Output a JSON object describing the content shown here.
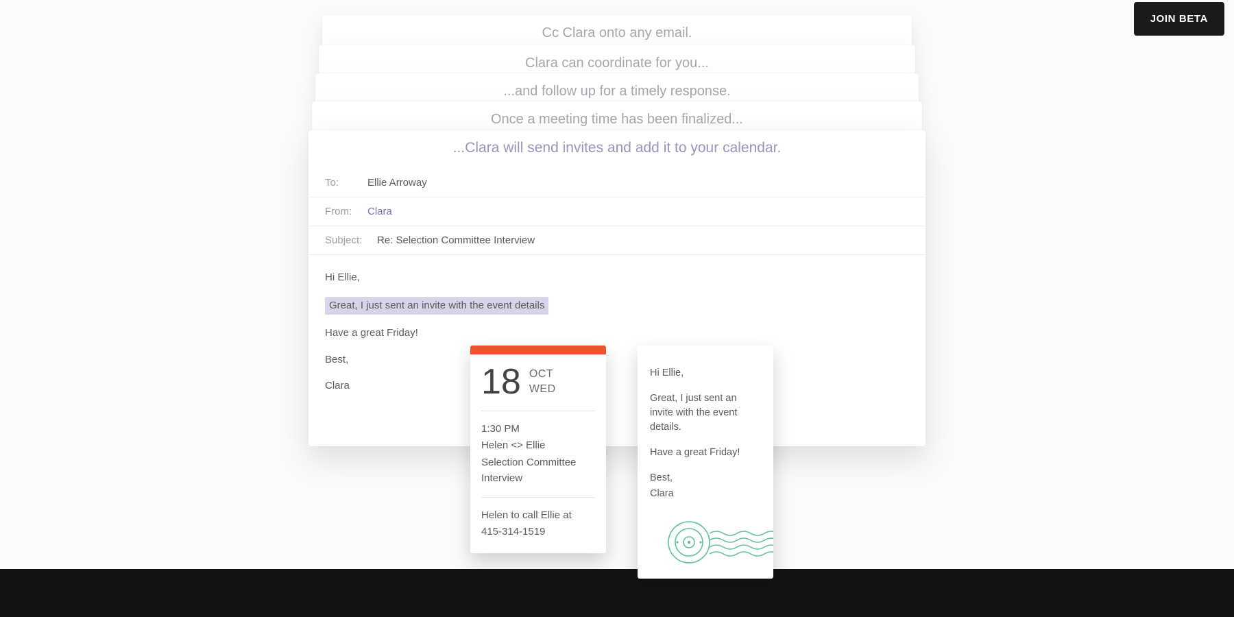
{
  "cta": {
    "join_beta": "JOIN BETA"
  },
  "stack": [
    "Cc Clara onto any email.",
    "Clara can coordinate for you...",
    "...and follow up for a timely response.",
    "Once a meeting time has been finalized..."
  ],
  "main": {
    "headline": "...Clara will send invites and add it to your calendar.",
    "to_label": "To:",
    "to_value": "Ellie Arroway",
    "from_label": "From:",
    "from_value": "Clara",
    "subject_label": "Subject:",
    "subject_value": "Re: Selection Committee Interview",
    "body": {
      "greeting": "Hi Ellie,",
      "highlight": "Great, I just sent an invite with the event details",
      "line2": "Have a great Friday!",
      "signoff1": "Best,",
      "signoff2": "Clara"
    }
  },
  "calendar": {
    "stripe_color": "#e9552d",
    "day": "18",
    "month": "OCT",
    "weekday": "WED",
    "time": "1:30 PM",
    "participants": "Helen <> Ellie",
    "title": "Selection Committee Interview",
    "instruction1": "Helen to call Ellie at",
    "instruction2": "415-314-1519"
  },
  "note": {
    "greeting": "Hi Ellie,",
    "line1": "Great, I just sent an invite with the event details.",
    "line2": "Have a great Friday!",
    "signoff1": "Best,",
    "signoff2": "Clara",
    "stamp_color": "#5fbfa3"
  }
}
